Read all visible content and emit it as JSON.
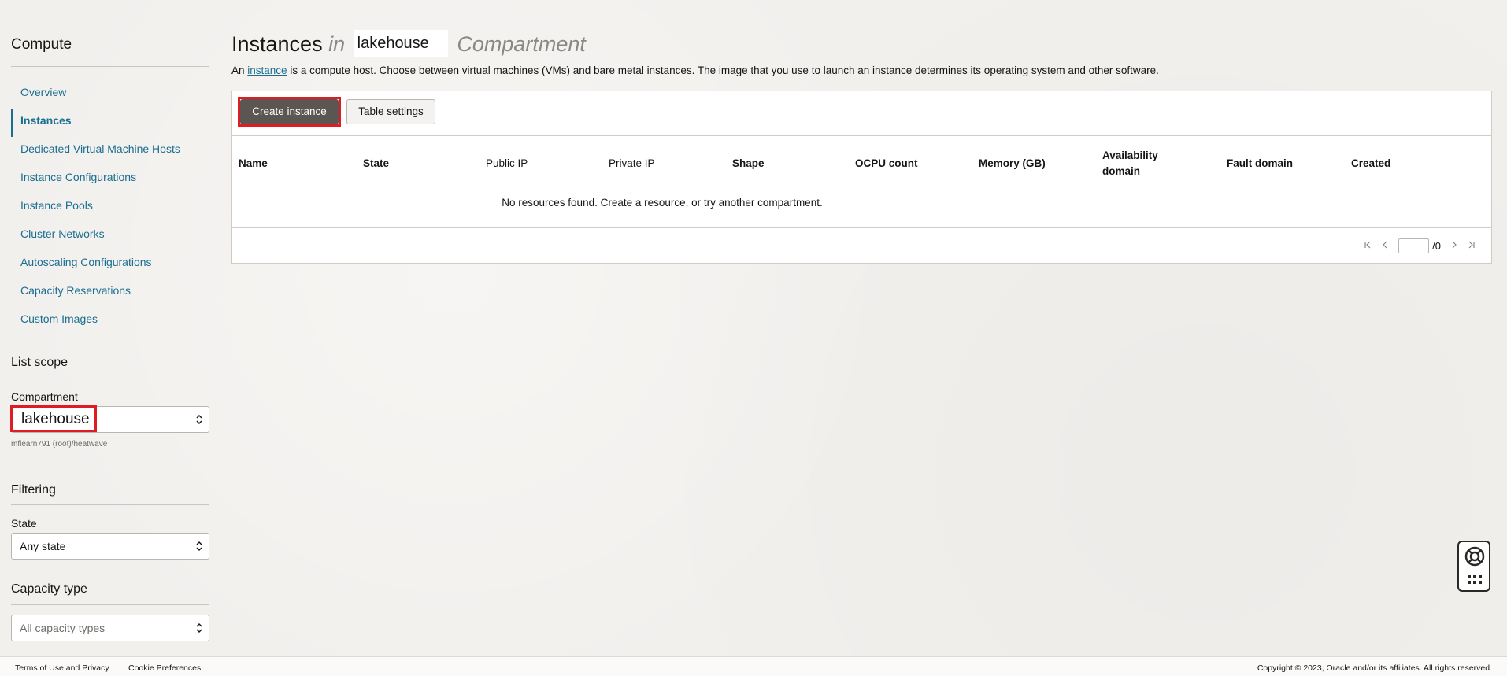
{
  "sidebar": {
    "title": "Compute",
    "nav": [
      {
        "label": "Overview",
        "active": false
      },
      {
        "label": "Instances",
        "active": true
      },
      {
        "label": "Dedicated Virtual Machine Hosts",
        "active": false
      },
      {
        "label": "Instance Configurations",
        "active": false
      },
      {
        "label": "Instance Pools",
        "active": false
      },
      {
        "label": "Cluster Networks",
        "active": false
      },
      {
        "label": "Autoscaling Configurations",
        "active": false
      },
      {
        "label": "Capacity Reservations",
        "active": false
      },
      {
        "label": "Custom Images",
        "active": false
      }
    ],
    "list_scope": {
      "title": "List scope",
      "compartment_label": "Compartment",
      "compartment_value": "lakehouse",
      "compartment_path": "mflearn791 (root)/heatwave"
    },
    "filtering": {
      "title": "Filtering",
      "state_label": "State",
      "state_value": "Any state"
    },
    "capacity": {
      "title": "Capacity type",
      "value": "All capacity types"
    }
  },
  "main": {
    "title": "Instances",
    "title_in": "in",
    "compartment": "lakehouse",
    "title_suffix": "Compartment",
    "description": {
      "prefix": "An",
      "link": "instance",
      "rest": "is a compute host. Choose between virtual machines (VMs) and bare metal instances. The image that you use to launch an instance determines its operating system and other software."
    },
    "toolbar": {
      "create_label": "Create instance",
      "settings_label": "Table settings"
    },
    "table": {
      "columns": [
        "Name",
        "State",
        "Public IP",
        "Private IP",
        "Shape",
        "OCPU count",
        "Memory (GB)",
        "Availability domain",
        "Fault domain",
        "Created"
      ],
      "empty_message": "No resources found. Create a resource, or try another compartment."
    },
    "pagination": {
      "page_value": "",
      "total": "/0"
    }
  },
  "footer": {
    "terms": "Terms of Use and Privacy",
    "cookies": "Cookie Preferences",
    "copyright": "Copyright © 2023, Oracle and/or its affiliates. All rights reserved."
  },
  "colors": {
    "link": "#1a6e91",
    "primary_button": "#5b5652",
    "highlight": "#e01b24"
  },
  "icons": {
    "select_chevron": "chevron-up-down-icon",
    "pager_first": "first-page-icon",
    "pager_prev": "prev-page-icon",
    "pager_next": "next-page-icon",
    "pager_last": "last-page-icon",
    "help": "lifebuoy-icon",
    "help_menu": "grid-dots-icon"
  }
}
